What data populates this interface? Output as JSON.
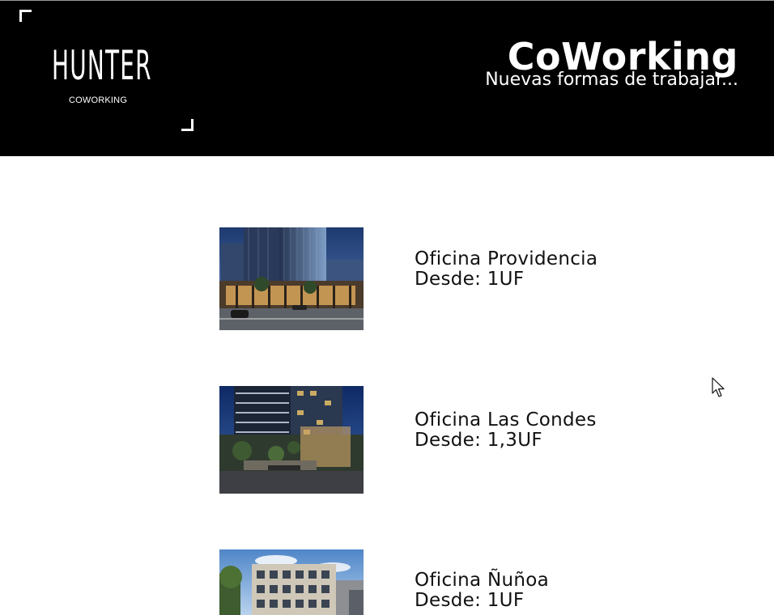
{
  "header": {
    "logo_title": "HUNTER",
    "logo_subtitle": "COWORKING",
    "title": "CoWorking",
    "subtitle": "Nuevas formas de trabajar..."
  },
  "offices": [
    {
      "name": "Oficina Providencia",
      "price": "Desde: 1UF",
      "image": "building-photo-providencia"
    },
    {
      "name": "Oficina Las Condes",
      "price": "Desde: 1,3UF",
      "image": "building-photo-las-condes"
    },
    {
      "name": "Oficina Ñuñoa",
      "price": "Desde: 1UF",
      "image": "building-photo-nunoa"
    }
  ],
  "colors": {
    "header_bg": "#000000",
    "text": "#111111",
    "page_bg": "#ffffff"
  },
  "icons": {
    "cursor": "arrow-cursor-icon"
  }
}
